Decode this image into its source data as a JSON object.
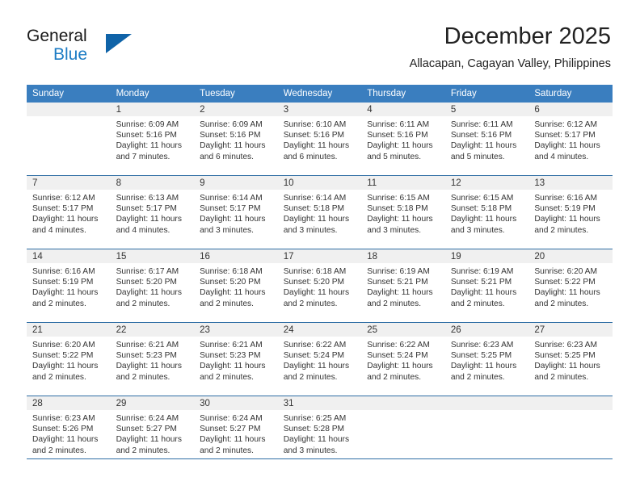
{
  "logo": {
    "line1": "General",
    "line2": "Blue",
    "triangle_color": "#0f63a8",
    "blue_color": "#1d7cc4"
  },
  "header": {
    "title": "December 2025",
    "location": "Allacapan, Cagayan Valley, Philippines"
  },
  "theme": {
    "header_bg": "#3a7ebf",
    "rule_color": "#2e6da4",
    "daynum_bg": "#f0f0f0",
    "text_color": "#333333"
  },
  "weekdays": [
    "Sunday",
    "Monday",
    "Tuesday",
    "Wednesday",
    "Thursday",
    "Friday",
    "Saturday"
  ],
  "weeks": [
    [
      {
        "day": "",
        "blank": true,
        "sunrise": "",
        "sunset": "",
        "daylight1": "",
        "daylight2": ""
      },
      {
        "day": "1",
        "sunrise": "Sunrise: 6:09 AM",
        "sunset": "Sunset: 5:16 PM",
        "daylight1": "Daylight: 11 hours",
        "daylight2": "and 7 minutes."
      },
      {
        "day": "2",
        "sunrise": "Sunrise: 6:09 AM",
        "sunset": "Sunset: 5:16 PM",
        "daylight1": "Daylight: 11 hours",
        "daylight2": "and 6 minutes."
      },
      {
        "day": "3",
        "sunrise": "Sunrise: 6:10 AM",
        "sunset": "Sunset: 5:16 PM",
        "daylight1": "Daylight: 11 hours",
        "daylight2": "and 6 minutes."
      },
      {
        "day": "4",
        "sunrise": "Sunrise: 6:11 AM",
        "sunset": "Sunset: 5:16 PM",
        "daylight1": "Daylight: 11 hours",
        "daylight2": "and 5 minutes."
      },
      {
        "day": "5",
        "sunrise": "Sunrise: 6:11 AM",
        "sunset": "Sunset: 5:16 PM",
        "daylight1": "Daylight: 11 hours",
        "daylight2": "and 5 minutes."
      },
      {
        "day": "6",
        "sunrise": "Sunrise: 6:12 AM",
        "sunset": "Sunset: 5:17 PM",
        "daylight1": "Daylight: 11 hours",
        "daylight2": "and 4 minutes."
      }
    ],
    [
      {
        "day": "7",
        "sunrise": "Sunrise: 6:12 AM",
        "sunset": "Sunset: 5:17 PM",
        "daylight1": "Daylight: 11 hours",
        "daylight2": "and 4 minutes."
      },
      {
        "day": "8",
        "sunrise": "Sunrise: 6:13 AM",
        "sunset": "Sunset: 5:17 PM",
        "daylight1": "Daylight: 11 hours",
        "daylight2": "and 4 minutes."
      },
      {
        "day": "9",
        "sunrise": "Sunrise: 6:14 AM",
        "sunset": "Sunset: 5:17 PM",
        "daylight1": "Daylight: 11 hours",
        "daylight2": "and 3 minutes."
      },
      {
        "day": "10",
        "sunrise": "Sunrise: 6:14 AM",
        "sunset": "Sunset: 5:18 PM",
        "daylight1": "Daylight: 11 hours",
        "daylight2": "and 3 minutes."
      },
      {
        "day": "11",
        "sunrise": "Sunrise: 6:15 AM",
        "sunset": "Sunset: 5:18 PM",
        "daylight1": "Daylight: 11 hours",
        "daylight2": "and 3 minutes."
      },
      {
        "day": "12",
        "sunrise": "Sunrise: 6:15 AM",
        "sunset": "Sunset: 5:18 PM",
        "daylight1": "Daylight: 11 hours",
        "daylight2": "and 3 minutes."
      },
      {
        "day": "13",
        "sunrise": "Sunrise: 6:16 AM",
        "sunset": "Sunset: 5:19 PM",
        "daylight1": "Daylight: 11 hours",
        "daylight2": "and 2 minutes."
      }
    ],
    [
      {
        "day": "14",
        "sunrise": "Sunrise: 6:16 AM",
        "sunset": "Sunset: 5:19 PM",
        "daylight1": "Daylight: 11 hours",
        "daylight2": "and 2 minutes."
      },
      {
        "day": "15",
        "sunrise": "Sunrise: 6:17 AM",
        "sunset": "Sunset: 5:20 PM",
        "daylight1": "Daylight: 11 hours",
        "daylight2": "and 2 minutes."
      },
      {
        "day": "16",
        "sunrise": "Sunrise: 6:18 AM",
        "sunset": "Sunset: 5:20 PM",
        "daylight1": "Daylight: 11 hours",
        "daylight2": "and 2 minutes."
      },
      {
        "day": "17",
        "sunrise": "Sunrise: 6:18 AM",
        "sunset": "Sunset: 5:20 PM",
        "daylight1": "Daylight: 11 hours",
        "daylight2": "and 2 minutes."
      },
      {
        "day": "18",
        "sunrise": "Sunrise: 6:19 AM",
        "sunset": "Sunset: 5:21 PM",
        "daylight1": "Daylight: 11 hours",
        "daylight2": "and 2 minutes."
      },
      {
        "day": "19",
        "sunrise": "Sunrise: 6:19 AM",
        "sunset": "Sunset: 5:21 PM",
        "daylight1": "Daylight: 11 hours",
        "daylight2": "and 2 minutes."
      },
      {
        "day": "20",
        "sunrise": "Sunrise: 6:20 AM",
        "sunset": "Sunset: 5:22 PM",
        "daylight1": "Daylight: 11 hours",
        "daylight2": "and 2 minutes."
      }
    ],
    [
      {
        "day": "21",
        "sunrise": "Sunrise: 6:20 AM",
        "sunset": "Sunset: 5:22 PM",
        "daylight1": "Daylight: 11 hours",
        "daylight2": "and 2 minutes."
      },
      {
        "day": "22",
        "sunrise": "Sunrise: 6:21 AM",
        "sunset": "Sunset: 5:23 PM",
        "daylight1": "Daylight: 11 hours",
        "daylight2": "and 2 minutes."
      },
      {
        "day": "23",
        "sunrise": "Sunrise: 6:21 AM",
        "sunset": "Sunset: 5:23 PM",
        "daylight1": "Daylight: 11 hours",
        "daylight2": "and 2 minutes."
      },
      {
        "day": "24",
        "sunrise": "Sunrise: 6:22 AM",
        "sunset": "Sunset: 5:24 PM",
        "daylight1": "Daylight: 11 hours",
        "daylight2": "and 2 minutes."
      },
      {
        "day": "25",
        "sunrise": "Sunrise: 6:22 AM",
        "sunset": "Sunset: 5:24 PM",
        "daylight1": "Daylight: 11 hours",
        "daylight2": "and 2 minutes."
      },
      {
        "day": "26",
        "sunrise": "Sunrise: 6:23 AM",
        "sunset": "Sunset: 5:25 PM",
        "daylight1": "Daylight: 11 hours",
        "daylight2": "and 2 minutes."
      },
      {
        "day": "27",
        "sunrise": "Sunrise: 6:23 AM",
        "sunset": "Sunset: 5:25 PM",
        "daylight1": "Daylight: 11 hours",
        "daylight2": "and 2 minutes."
      }
    ],
    [
      {
        "day": "28",
        "sunrise": "Sunrise: 6:23 AM",
        "sunset": "Sunset: 5:26 PM",
        "daylight1": "Daylight: 11 hours",
        "daylight2": "and 2 minutes."
      },
      {
        "day": "29",
        "sunrise": "Sunrise: 6:24 AM",
        "sunset": "Sunset: 5:27 PM",
        "daylight1": "Daylight: 11 hours",
        "daylight2": "and 2 minutes."
      },
      {
        "day": "30",
        "sunrise": "Sunrise: 6:24 AM",
        "sunset": "Sunset: 5:27 PM",
        "daylight1": "Daylight: 11 hours",
        "daylight2": "and 2 minutes."
      },
      {
        "day": "31",
        "sunrise": "Sunrise: 6:25 AM",
        "sunset": "Sunset: 5:28 PM",
        "daylight1": "Daylight: 11 hours",
        "daylight2": "and 3 minutes."
      },
      {
        "day": "",
        "blank": true,
        "sunrise": "",
        "sunset": "",
        "daylight1": "",
        "daylight2": ""
      },
      {
        "day": "",
        "blank": true,
        "sunrise": "",
        "sunset": "",
        "daylight1": "",
        "daylight2": ""
      },
      {
        "day": "",
        "blank": true,
        "sunrise": "",
        "sunset": "",
        "daylight1": "",
        "daylight2": ""
      }
    ]
  ]
}
